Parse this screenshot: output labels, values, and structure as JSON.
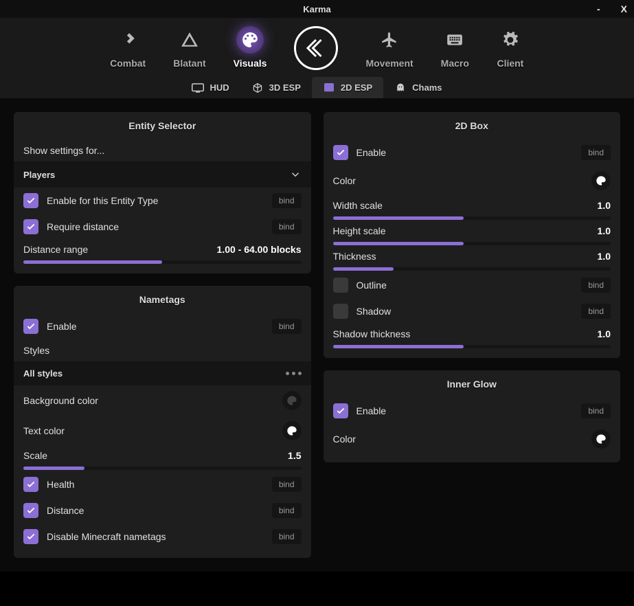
{
  "title": "Karma",
  "win": {
    "min": "-",
    "close": "X"
  },
  "nav": {
    "tabs": [
      {
        "label": "Combat"
      },
      {
        "label": "Blatant"
      },
      {
        "label": "Visuals"
      },
      {
        "label": "Movement"
      },
      {
        "label": "Macro"
      },
      {
        "label": "Client"
      }
    ]
  },
  "subtabs": [
    {
      "label": "HUD"
    },
    {
      "label": "3D ESP"
    },
    {
      "label": "2D ESP"
    },
    {
      "label": "Chams"
    }
  ],
  "entity": {
    "title": "Entity Selector",
    "show_label": "Show settings for...",
    "dropdown": "Players",
    "enable_type": "Enable for this Entity Type",
    "require_dist": "Require distance",
    "dist_range": "Distance range",
    "dist_value": "1.00 - 64.00 blocks",
    "bind": "bind"
  },
  "nametags": {
    "title": "Nametags",
    "enable": "Enable",
    "styles": "Styles",
    "all_styles": "All styles",
    "bg_color": "Background color",
    "text_color": "Text color",
    "scale": "Scale",
    "scale_val": "1.5",
    "health": "Health",
    "distance": "Distance",
    "disable_mc": "Disable Minecraft nametags",
    "bind": "bind"
  },
  "box2d": {
    "title": "2D Box",
    "enable": "Enable",
    "color": "Color",
    "width": "Width scale",
    "width_val": "1.0",
    "height": "Height scale",
    "height_val": "1.0",
    "thick": "Thickness",
    "thick_val": "1.0",
    "outline": "Outline",
    "shadow": "Shadow",
    "sthick": "Shadow thickness",
    "sthick_val": "1.0",
    "bind": "bind"
  },
  "glow": {
    "title": "Inner Glow",
    "enable": "Enable",
    "color": "Color",
    "bind": "bind"
  }
}
